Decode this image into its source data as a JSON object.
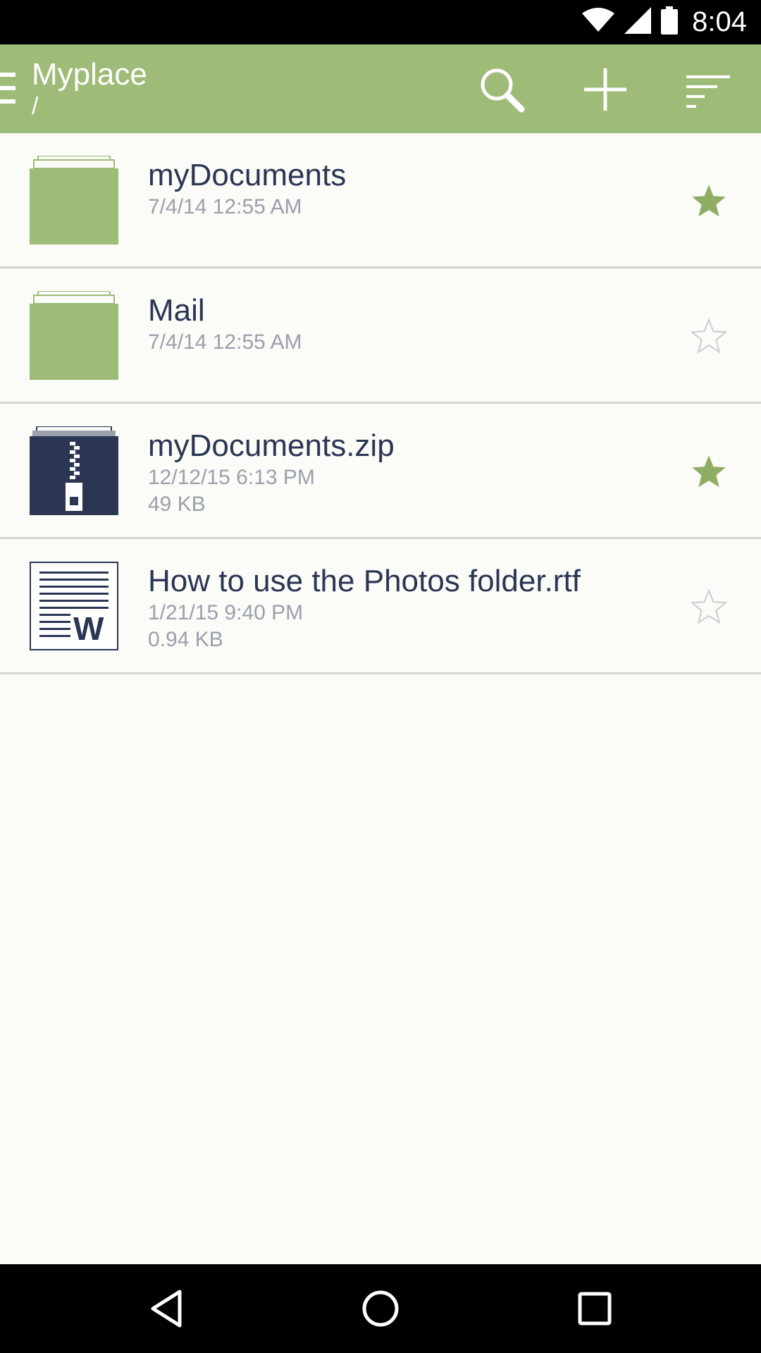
{
  "status_bar": {
    "time": "8:04",
    "icons": [
      "wifi-icon",
      "signal-icon",
      "battery-icon"
    ]
  },
  "app_bar": {
    "title": "Myplace",
    "path": "/",
    "actions": [
      "search-icon",
      "add-icon",
      "sort-icon"
    ]
  },
  "colors": {
    "accent": "#9fbb78",
    "text_primary": "#2b3653",
    "text_secondary": "#9aa0ac",
    "star_active": "#8fae64",
    "background": "#fbfbf7"
  },
  "files": [
    {
      "name": "myDocuments",
      "date": "7/4/14 12:55 AM",
      "size": "",
      "type": "folder",
      "icon": "folder-icon",
      "starred": true
    },
    {
      "name": "Mail",
      "date": "7/4/14 12:55 AM",
      "size": "",
      "type": "folder",
      "icon": "folder-icon",
      "starred": false
    },
    {
      "name": "myDocuments.zip",
      "date": "12/12/15 6:13 PM",
      "size": "49 KB",
      "type": "zip",
      "icon": "zip-file-icon",
      "starred": true
    },
    {
      "name": "How to use the Photos folder.rtf",
      "date": "1/21/15 9:40 PM",
      "size": "0.94 KB",
      "type": "rtf",
      "icon": "word-document-icon",
      "starred": false
    }
  ],
  "nav_bar": {
    "buttons": [
      "back-icon",
      "home-icon",
      "recents-icon"
    ]
  }
}
